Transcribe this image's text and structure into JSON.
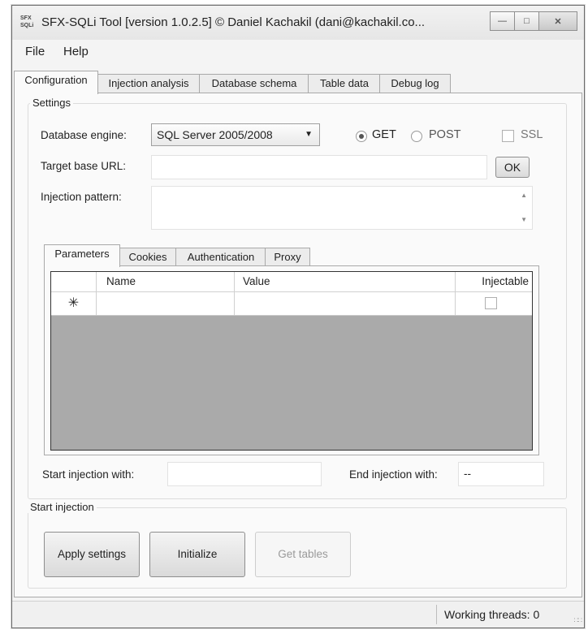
{
  "window": {
    "title": "SFX-SQLi Tool  [version 1.0.2.5]  © Daniel Kachakil (dani@kachakil.co...",
    "icon_text": "SFX SQLi"
  },
  "menu": [
    "File",
    "Help"
  ],
  "tabs": [
    "Configuration",
    "Injection analysis",
    "Database schema",
    "Table data",
    "Debug log"
  ],
  "settings": {
    "legend": "Settings",
    "db_engine_label": "Database engine:",
    "db_engine_value": "SQL Server 2005/2008",
    "method_get": "GET",
    "method_post": "POST",
    "ssl": "SSL",
    "target_url_label": "Target base URL:",
    "target_url_value": "",
    "ok_button": "OK",
    "injection_pattern_label": "Injection pattern:",
    "injection_pattern_value": ""
  },
  "subtabs": [
    "Parameters",
    "Cookies",
    "Authentication",
    "Proxy"
  ],
  "grid": {
    "columns": [
      "Name",
      "Value",
      "Injectable"
    ],
    "new_row_marker": "✳"
  },
  "injection": {
    "start_label": "Start injection with:",
    "start_value": "",
    "end_label": "End injection with:",
    "end_value": "--"
  },
  "start_group": {
    "legend": "Start injection",
    "apply_button": "Apply settings",
    "initialize_button": "Initialize",
    "get_tables_button": "Get tables"
  },
  "status": {
    "threads": "Working threads: 0"
  },
  "icons": {
    "minimize": "minimize-icon",
    "maximize": "maximize-icon",
    "close": "close-icon",
    "dropdown": "chevron-down-icon",
    "resize": "resize-grip-icon"
  }
}
